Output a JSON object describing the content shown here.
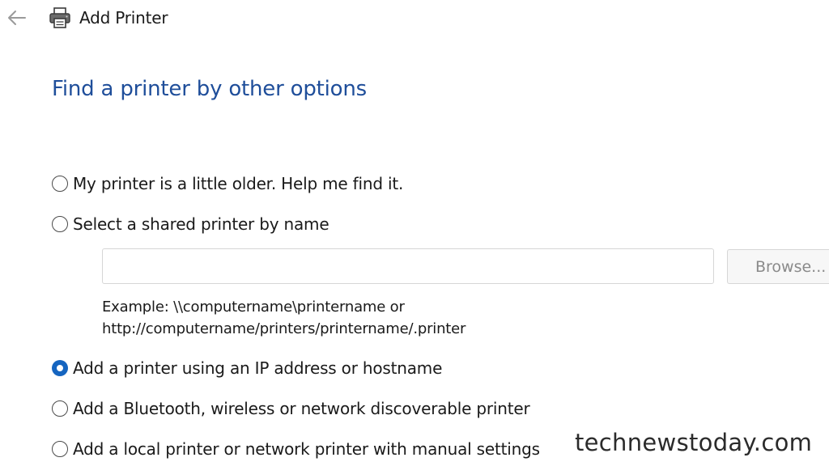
{
  "titlebar": {
    "back_icon": "arrow-left-icon",
    "printer_icon": "printer-icon",
    "title": "Add Printer"
  },
  "main": {
    "heading": "Find a printer by other options",
    "options": [
      {
        "label": "My printer is a little older. Help me find it.",
        "checked": false
      },
      {
        "label": "Select a shared printer by name",
        "checked": false
      },
      {
        "label": "Add a printer using an IP address or hostname",
        "checked": true
      },
      {
        "label": "Add a Bluetooth, wireless or network discoverable printer",
        "checked": false
      },
      {
        "label": "Add a local printer or network printer with manual settings",
        "checked": false
      }
    ],
    "shared_printer": {
      "value": "",
      "browse_label": "Browse...",
      "example_line1": "Example: \\\\computername\\printername or",
      "example_line2": "http://computername/printers/printername/.printer"
    }
  },
  "watermark": "technewstoday.com",
  "colors": {
    "heading": "#1f4e9a",
    "radio_selected": "#1565c0",
    "text": "#1a1a1a",
    "disabled_text": "#8a8a8a"
  }
}
